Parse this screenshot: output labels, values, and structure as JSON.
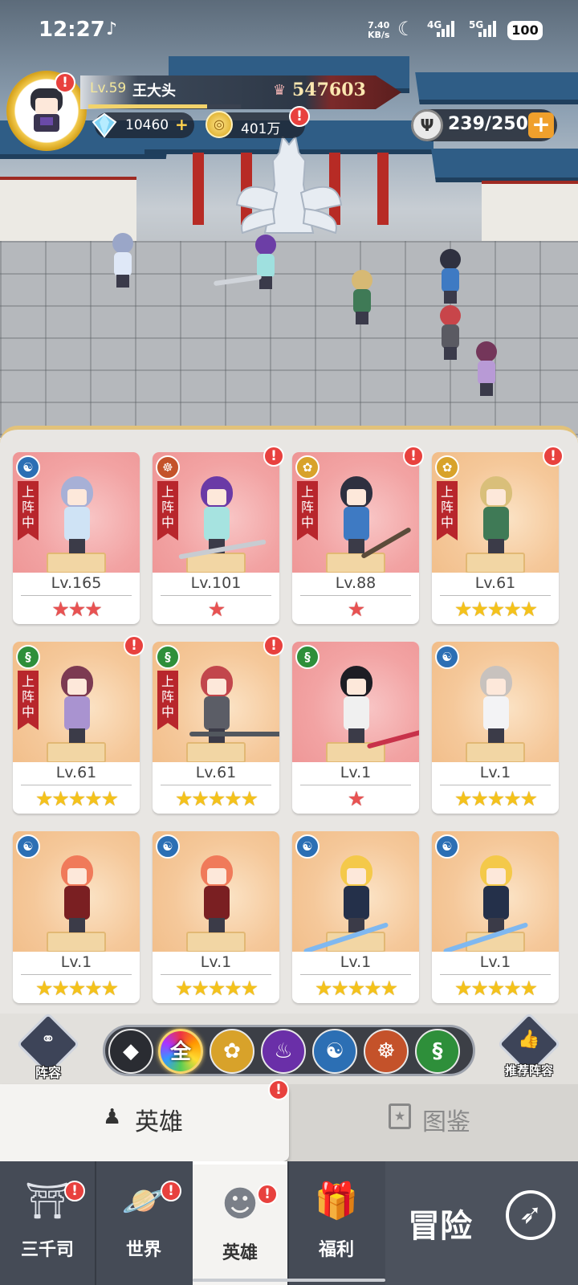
{
  "status_bar": {
    "time": "12:27",
    "net_speed": "7.40",
    "net_unit": "KB/s",
    "signal_4g": "4G",
    "signal_5g": "5G",
    "battery": "100"
  },
  "player": {
    "level": "Lv.59",
    "name": "王大头",
    "power": "547603",
    "xp_fraction": 0.78,
    "gems": "10460",
    "gold": "401万",
    "stamina": "239/250"
  },
  "heroes": [
    {
      "level": "Lv.165",
      "stars": "★★★",
      "star_color": "red",
      "bg": "red",
      "deployed": true,
      "alert": false,
      "faction": "water"
    },
    {
      "level": "Lv.101",
      "stars": "★",
      "star_color": "red",
      "bg": "red",
      "deployed": true,
      "alert": true,
      "faction": "zen"
    },
    {
      "level": "Lv.88",
      "stars": "★",
      "star_color": "red",
      "bg": "red",
      "deployed": true,
      "alert": true,
      "faction": "lotus"
    },
    {
      "level": "Lv.61",
      "stars": "★★★★★",
      "star_color": "gold",
      "bg": "gold",
      "deployed": true,
      "alert": true,
      "faction": "lotus"
    },
    {
      "level": "Lv.61",
      "stars": "★★★★★",
      "star_color": "gold",
      "bg": "gold",
      "deployed": true,
      "alert": true,
      "faction": "dna"
    },
    {
      "level": "Lv.61",
      "stars": "★★★★★",
      "star_color": "gold",
      "bg": "gold",
      "deployed": true,
      "alert": true,
      "faction": "dna"
    },
    {
      "level": "Lv.1",
      "stars": "★",
      "star_color": "red",
      "bg": "red",
      "deployed": false,
      "alert": false,
      "faction": "dna"
    },
    {
      "level": "Lv.1",
      "stars": "★★★★★",
      "star_color": "gold",
      "bg": "gold",
      "deployed": false,
      "alert": false,
      "faction": "water"
    },
    {
      "level": "Lv.1",
      "stars": "★★★★★",
      "star_color": "gold",
      "bg": "gold",
      "deployed": false,
      "alert": false,
      "faction": "water"
    },
    {
      "level": "Lv.1",
      "stars": "★★★★★",
      "star_color": "gold",
      "bg": "gold",
      "deployed": false,
      "alert": false,
      "faction": "water"
    },
    {
      "level": "Lv.1",
      "stars": "★★★★★",
      "star_color": "gold",
      "bg": "gold",
      "deployed": false,
      "alert": false,
      "faction": "water"
    },
    {
      "level": "Lv.1",
      "stars": "★★★★★",
      "star_color": "gold",
      "bg": "gold",
      "deployed": false,
      "alert": false,
      "faction": "water"
    }
  ],
  "deploy_tag": "上阵中",
  "filter": {
    "lineup_label": "阵容",
    "recommend_label": "推荐阵容",
    "all_label": "全"
  },
  "tabs": {
    "hero": "英雄",
    "guide": "图鉴"
  },
  "nav": {
    "sanqian": "三千司",
    "world": "世界",
    "hero": "英雄",
    "welfare": "福利",
    "adventure": "冒险"
  },
  "colors": {
    "accent_gold": "#f4c21b",
    "alert_red": "#e8413e",
    "deploy_red": "#b8262c"
  }
}
